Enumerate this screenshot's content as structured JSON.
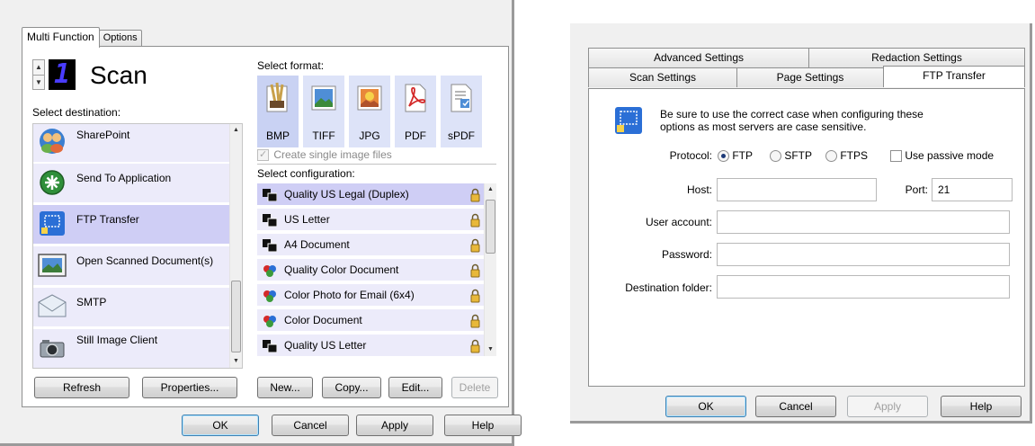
{
  "left": {
    "tabs": [
      "Multi Function",
      "Options"
    ],
    "counter": "1",
    "scan_title": "Scan",
    "select_destination": "Select destination:",
    "destinations": [
      {
        "label": "SharePoint",
        "icon": "sharepoint-icon"
      },
      {
        "label": "Send To Application",
        "icon": "send-to-application-icon"
      },
      {
        "label": "FTP Transfer",
        "icon": "ftp-transfer-icon"
      },
      {
        "label": "Open Scanned Document(s)",
        "icon": "open-document-icon"
      },
      {
        "label": "SMTP",
        "icon": "smtp-envelope-icon"
      },
      {
        "label": "Still Image Client",
        "icon": "camera-icon"
      }
    ],
    "selected_destination": "FTP Transfer",
    "select_format": "Select format:",
    "formats": [
      "BMP",
      "TIFF",
      "JPG",
      "PDF",
      "sPDF"
    ],
    "selected_format": "BMP",
    "single_image": "Create single image files",
    "select_configuration": "Select configuration:",
    "configurations": [
      "Quality US Legal (Duplex)",
      "US Letter",
      "A4 Document",
      "Quality Color Document",
      "Color Photo for Email (6x4)",
      "Color Document",
      "Quality US Letter"
    ],
    "selected_configuration": "Quality US Legal (Duplex)",
    "buttons": {
      "refresh": "Refresh",
      "properties": "Properties...",
      "new": "New...",
      "copy": "Copy...",
      "edit": "Edit...",
      "delete": "Delete",
      "ok": "OK",
      "cancel": "Cancel",
      "apply": "Apply",
      "help": "Help"
    }
  },
  "right": {
    "tabs_row1": [
      "Advanced Settings",
      "Redaction Settings"
    ],
    "tabs_row2": [
      "Scan Settings",
      "Page Settings",
      "FTP Transfer"
    ],
    "active_tab": "FTP Transfer",
    "info_line1": "Be sure to use the correct case when configuring these",
    "info_line2": "options as most servers are case sensitive.",
    "protocol_label": "Protocol:",
    "protocols": [
      "FTP",
      "SFTP",
      "FTPS"
    ],
    "selected_protocol": "FTP",
    "passive_mode": "Use passive mode",
    "host_label": "Host:",
    "host_value": "",
    "port_label": "Port:",
    "port_value": "21",
    "user_label": "User account:",
    "user_value": "",
    "password_label": "Password:",
    "password_value": "",
    "folder_label": "Destination folder:",
    "folder_value": "",
    "buttons": {
      "ok": "OK",
      "cancel": "Cancel",
      "apply": "Apply",
      "help": "Help"
    }
  },
  "colors": {
    "selection": "#cfcef5",
    "list_item": "#ecebfa",
    "format_tile": "#dde3f8",
    "counter_digit": "#4a3cff"
  }
}
